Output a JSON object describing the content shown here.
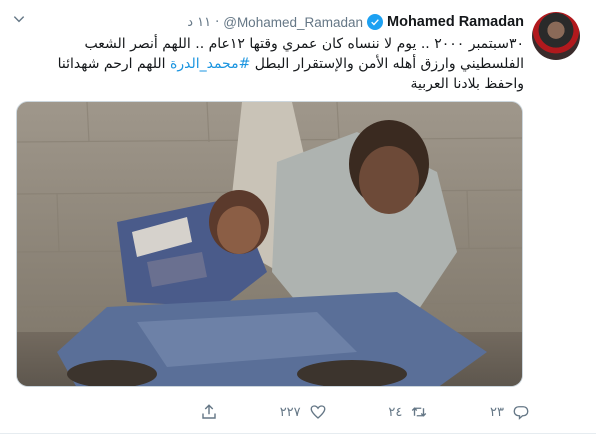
{
  "tweet": {
    "author": {
      "name": "Mohamed Ramadan",
      "handle": "@Mohamed_Ramadan",
      "date": "١١ د"
    },
    "text_lines": [
      "٣٠سبتمبر ٢٠٠٠ .. يوم لا ننساه كان عمري وقتها ١٢عام .. اللهم أنصر الشعب",
      "الفلسطيني وارزق أهله الأمن والإستقرار البطل",
      "اللهم ارحم شهدائنا",
      "واحفظ بلادنا العربية"
    ],
    "hashtag": "#محمد_الدرة",
    "actions": {
      "reply_count": "٢٣",
      "retweet_count": "٢٤",
      "like_count": "٢٢٧"
    }
  },
  "icons": {
    "verified": "verified-badge-icon",
    "chevron": "chevron-down-icon",
    "reply": "reply-icon",
    "retweet": "retweet-icon",
    "like": "heart-icon",
    "share": "share-icon"
  },
  "colors": {
    "accent": "#1da1f2",
    "link": "#1b95e0",
    "secondary_text": "#657786",
    "primary_text": "#14171a"
  }
}
